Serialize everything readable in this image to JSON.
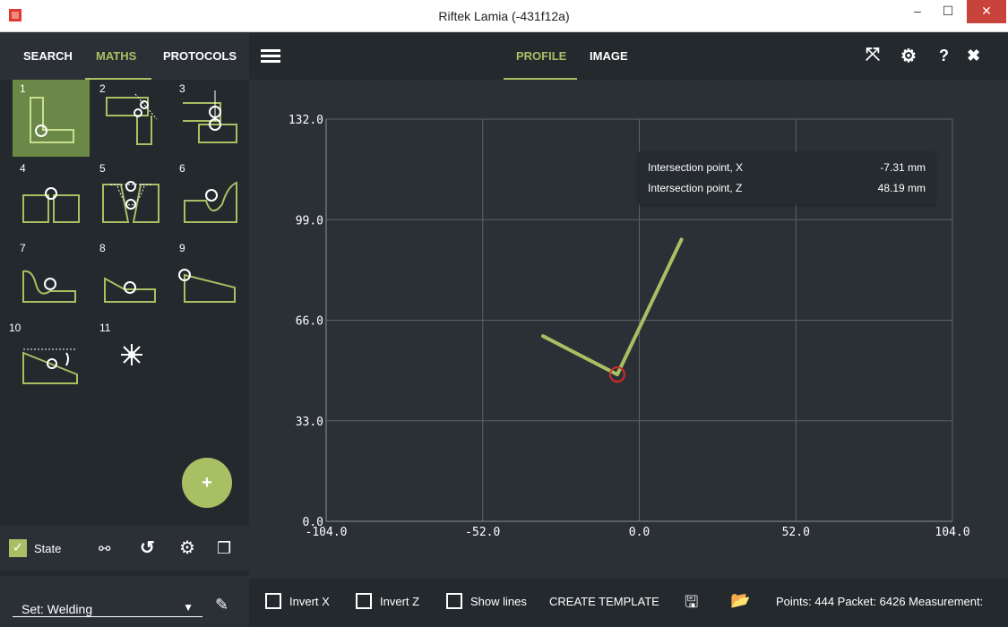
{
  "window": {
    "title": "Riftek Lamia (-431f12a)",
    "minimize": "–",
    "maximize": "☐",
    "close": "✕"
  },
  "sidebar": {
    "tabs": [
      "SEARCH",
      "MATHS",
      "PROTOCOLS"
    ],
    "active_tab": "MATHS",
    "tiles": [
      "1",
      "2",
      "3",
      "4",
      "5",
      "6",
      "7",
      "8",
      "9",
      "10",
      "11"
    ],
    "selected_tile": "1",
    "fab_label": "+",
    "state_label": "State",
    "set_label": "Set: Welding"
  },
  "main": {
    "tabs": [
      "PROFILE",
      "IMAGE"
    ],
    "active_tab": "PROFILE"
  },
  "tooltip": {
    "rows": [
      {
        "label": "Intersection point, X",
        "value": "-7.31 mm"
      },
      {
        "label": "Intersection point, Z",
        "value": "48.19 mm"
      }
    ]
  },
  "bottom": {
    "invert_x": "Invert X",
    "invert_z": "Invert Z",
    "show_lines": "Show lines",
    "create_template": "CREATE TEMPLATE",
    "status": "Points: 444  Packet: 6426  Measurement:"
  },
  "chart_data": {
    "type": "line",
    "x_ticks": [
      "-104.0",
      "-52.0",
      "0.0",
      "52.0",
      "104.0"
    ],
    "y_ticks": [
      "0.0",
      "33.0",
      "66.0",
      "99.0",
      "132.0"
    ],
    "xlim": [
      -104,
      104
    ],
    "ylim": [
      0,
      132
    ],
    "grid": true,
    "series": [
      {
        "points": [
          [
            -32,
            60.8
          ],
          [
            -7.31,
            48.19
          ],
          [
            14,
            92.5
          ]
        ],
        "color": "#a7c063"
      }
    ],
    "marker": {
      "x": -7.31,
      "z": 48.19,
      "color": "#d62b2b"
    }
  }
}
